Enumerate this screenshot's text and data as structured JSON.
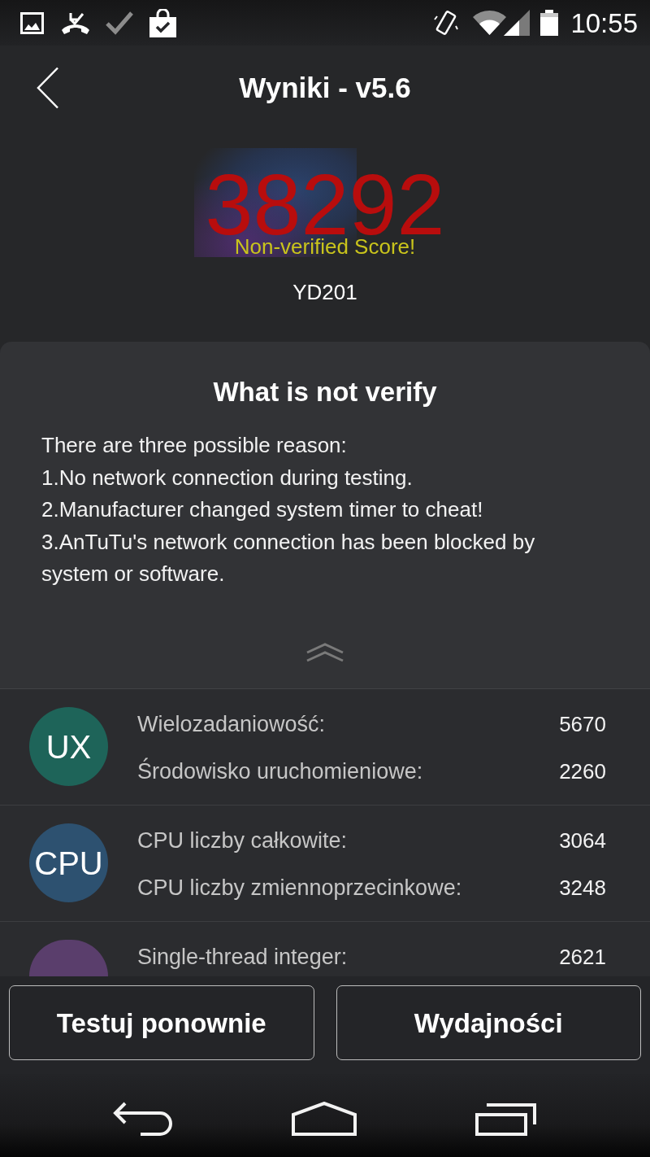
{
  "status_bar": {
    "time": "10:55"
  },
  "header": {
    "title": "Wyniki - v5.6"
  },
  "score": {
    "value": "38292",
    "notice": "Non-verified Score!",
    "device": "YD201"
  },
  "info_panel": {
    "title": "What is not verify",
    "lines": [
      "There are three possible reason:",
      "1.No network connection during testing.",
      "2.Manufacturer changed system timer to cheat!",
      "3.AnTuTu's network connection has been blocked by system or software."
    ]
  },
  "results": [
    {
      "badge": "UX",
      "color": "#1e6459",
      "items": [
        {
          "label": "Wielozadaniowość:",
          "value": "5670"
        },
        {
          "label": "Środowisko uruchomieniowe:",
          "value": "2260"
        }
      ]
    },
    {
      "badge": "CPU",
      "color": "#2d5170",
      "items": [
        {
          "label": "CPU liczby całkowite:",
          "value": "3064"
        },
        {
          "label": "CPU liczby zmiennoprzecinkowe:",
          "value": "3248"
        }
      ]
    },
    {
      "color": "#5a3e6c",
      "items": [
        {
          "label": "Single-thread integer:",
          "value": "2621"
        }
      ]
    }
  ],
  "buttons": [
    "Testuj ponownie",
    "Wydajności"
  ]
}
